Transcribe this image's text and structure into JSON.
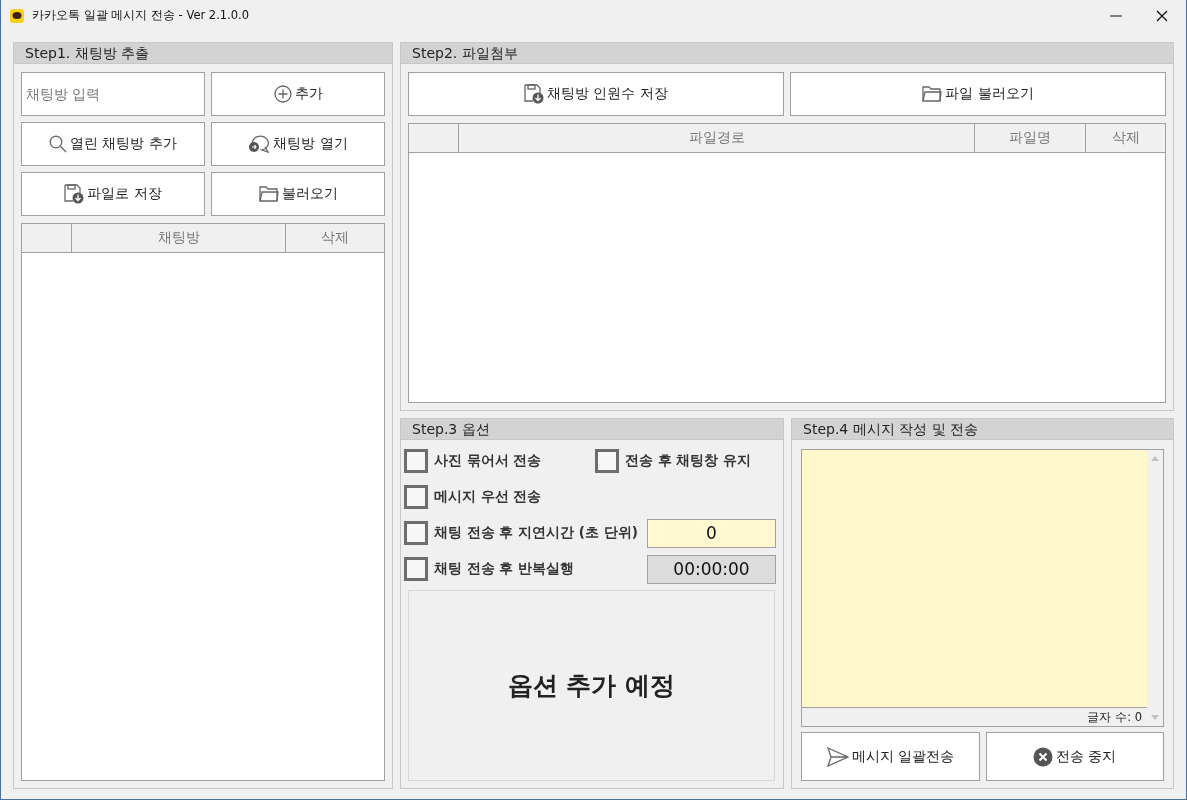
{
  "window": {
    "title": "카카오톡 일괄 메시지 전송 - Ver 2.1.0.0"
  },
  "step1": {
    "title": "Step1. 채팅방 추출",
    "input": {
      "placeholder": "채팅방 입력"
    },
    "buttons": [
      {
        "label": "추가"
      },
      {
        "label": "열린 채팅방 추가"
      },
      {
        "label": "채팅방 열기"
      },
      {
        "label": "파일로 저장"
      },
      {
        "label": "불러오기"
      }
    ],
    "table": {
      "columns": [
        "채팅방",
        "삭제"
      ]
    }
  },
  "step2": {
    "title": "Step2. 파일첨부",
    "buttons": [
      {
        "label": "채팅방 인원수 저장"
      },
      {
        "label": "파일 불러오기"
      }
    ],
    "table": {
      "columns": [
        "파일경로",
        "파일명",
        "삭제"
      ]
    }
  },
  "step3": {
    "title": "Step.3 옵션",
    "rows": [
      [
        {
          "kind": "checkbox",
          "label": "사진 묶어서 전송",
          "checked": false
        },
        {
          "kind": "checkbox",
          "label": "전송 후 채팅창 유지",
          "checked": false
        }
      ],
      [
        {
          "kind": "checkbox",
          "label": "메시지 우선 전송",
          "checked": false
        }
      ],
      [
        {
          "kind": "checkbox",
          "label": "채팅 전송 후 지연시간 (초 단위)",
          "checked": false
        },
        {
          "kind": "field",
          "value": "0"
        }
      ],
      [
        {
          "kind": "checkbox",
          "label": "채팅 전송 후 반복실행",
          "checked": false
        },
        {
          "kind": "display",
          "value": "00:00:00"
        }
      ]
    ],
    "notice": "옵션 추가 예정"
  },
  "step4": {
    "title": "Step.4 메시지 작성 및 전송",
    "char_count": "글자 수: 0",
    "buttons": [
      {
        "label": "메시지 일괄전송"
      },
      {
        "label": "전송 중지"
      }
    ]
  }
}
